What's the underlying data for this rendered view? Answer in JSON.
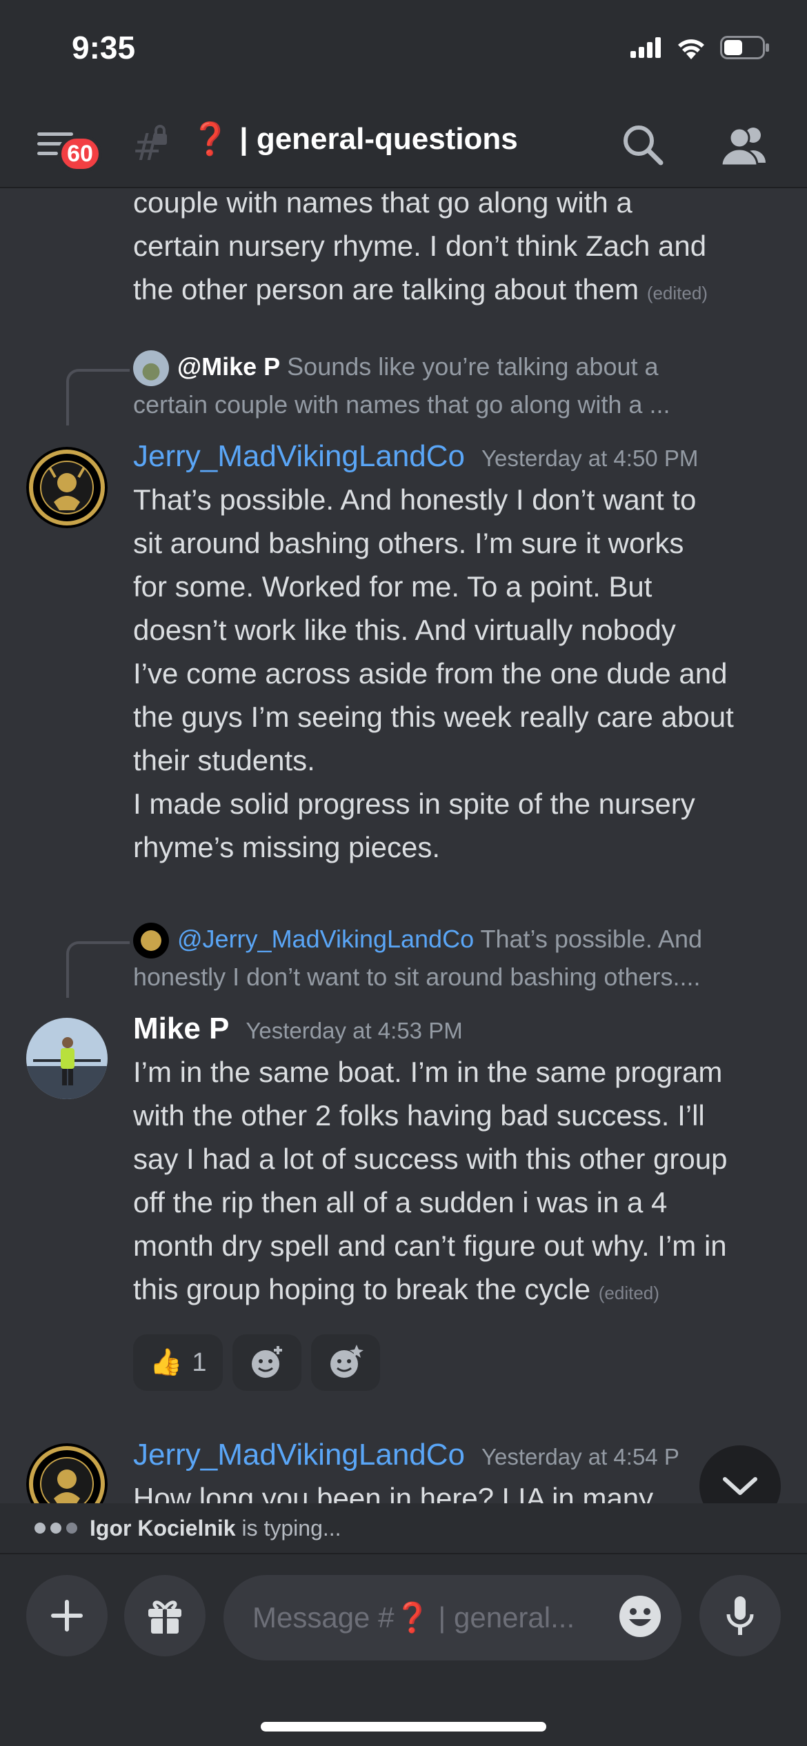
{
  "status_bar": {
    "time": "9:35"
  },
  "header": {
    "badge_count": "60",
    "channel_emoji": "❓",
    "channel_name": "| general-questions"
  },
  "messages": {
    "top_continuation": {
      "lines": [
        "couple with names that go along with a",
        "certain nursery rhyme. I don’t think Zach and",
        "the other person are talking about them"
      ],
      "edited": "(edited)"
    },
    "jerry_1": {
      "reply_name": "@Mike P",
      "reply_text_1": "Sounds like you’re talking about a",
      "reply_text_2": "certain couple with names that go along with a ...",
      "author": "Jerry_MadVikingLandCo",
      "timestamp": "Yesterday at 4:50 PM",
      "body_lines": [
        "That’s possible.  And honestly I don’t want to",
        "sit around bashing others.  I’m sure it works",
        "for some.  Worked for me.  To a point.  But",
        "doesn’t work like this.  And virtually nobody",
        "I’ve come across aside from the one dude and",
        "the guys I’m seeing this week really care about",
        "their students."
      ],
      "body2_lines": [
        "I made solid progress in spite of the nursery",
        "rhyme’s missing pieces."
      ]
    },
    "mike_1": {
      "reply_name": "@Jerry_MadVikingLandCo",
      "reply_text_1": "That’s possible.  And",
      "reply_text_2": "honestly I don’t want to sit around bashing others....",
      "author": "Mike P",
      "timestamp": "Yesterday at 4:53 PM",
      "body_lines": [
        "I’m in the same boat. I’m in the same program",
        "with the other 2 folks having bad success. I’ll",
        "say I had a lot of success with this other group",
        "off the rip then all of a sudden i was in a 4",
        "month dry spell and can’t figure out why. I’m in",
        "this group hoping to break the cycle"
      ],
      "edited": "(edited)",
      "reaction_emoji": "👍",
      "reaction_count": "1"
    },
    "jerry_2": {
      "author": "Jerry_MadVikingLandCo",
      "timestamp": "Yesterday at 4:54 P",
      "body_partial": "How long you been in here? LIA in many"
    }
  },
  "typing": {
    "user": "Igor Kocielnik",
    "suffix": "is typing..."
  },
  "composer": {
    "placeholder": "Message #❓ | general..."
  },
  "colors": {
    "background": "#313338",
    "username_blue": "#5aa6f7",
    "badge_red": "#f23f43"
  }
}
